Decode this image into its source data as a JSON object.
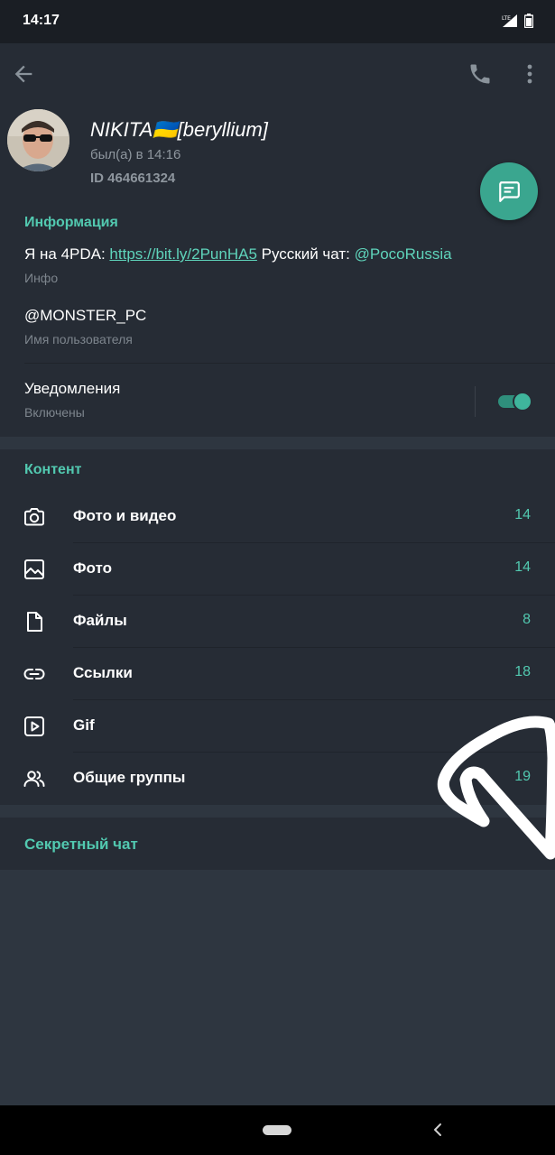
{
  "status_bar": {
    "time": "14:17",
    "network": "LTE"
  },
  "profile": {
    "name": "NIKITA🇺🇦[beryllium]",
    "last_seen": "был(а) в 14:16",
    "user_id": "ID 464661324"
  },
  "info_section": {
    "title": "Информация",
    "bio_prefix": "Я на 4PDA: ",
    "bio_link": "https://bit.ly/2PunHA5",
    "bio_middle": " Русский чат: ",
    "bio_mention": "@PocoRussia",
    "bio_caption": "Инфо",
    "username": "@MONSTER_PC",
    "username_caption": "Имя пользователя",
    "notifications_label": "Уведомления",
    "notifications_status": "Включены",
    "notifications_enabled": true
  },
  "content_section": {
    "title": "Контент",
    "items": [
      {
        "label": "Фото и видео",
        "count": "14",
        "icon": "camera-icon"
      },
      {
        "label": "Фото",
        "count": "14",
        "icon": "image-icon"
      },
      {
        "label": "Файлы",
        "count": "8",
        "icon": "file-icon"
      },
      {
        "label": "Ссылки",
        "count": "18",
        "icon": "link-icon"
      },
      {
        "label": "Gif",
        "count": "",
        "icon": "gif-play-icon"
      },
      {
        "label": "Общие группы",
        "count": "19",
        "icon": "groups-icon"
      }
    ]
  },
  "secret_chat": {
    "label": "Секретный чат"
  },
  "colors": {
    "accent": "#52c9b0",
    "fab": "#3aa68f",
    "section_bg": "#262c35",
    "page_bg": "#2e3640"
  }
}
